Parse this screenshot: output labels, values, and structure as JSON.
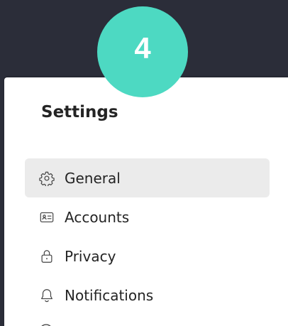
{
  "badge": {
    "number": "4",
    "color": "#4dd9c2"
  },
  "settings": {
    "title": "Settings",
    "items": [
      {
        "label": "General",
        "icon": "gear-icon",
        "selected": true
      },
      {
        "label": "Accounts",
        "icon": "id-card-icon",
        "selected": false
      },
      {
        "label": "Privacy",
        "icon": "lock-icon",
        "selected": false
      },
      {
        "label": "Notifications",
        "icon": "bell-icon",
        "selected": false
      }
    ]
  },
  "colors": {
    "backdrop": "#2b2d39",
    "panel": "#ffffff",
    "selected_item": "#ebebeb",
    "text": "#242424"
  }
}
